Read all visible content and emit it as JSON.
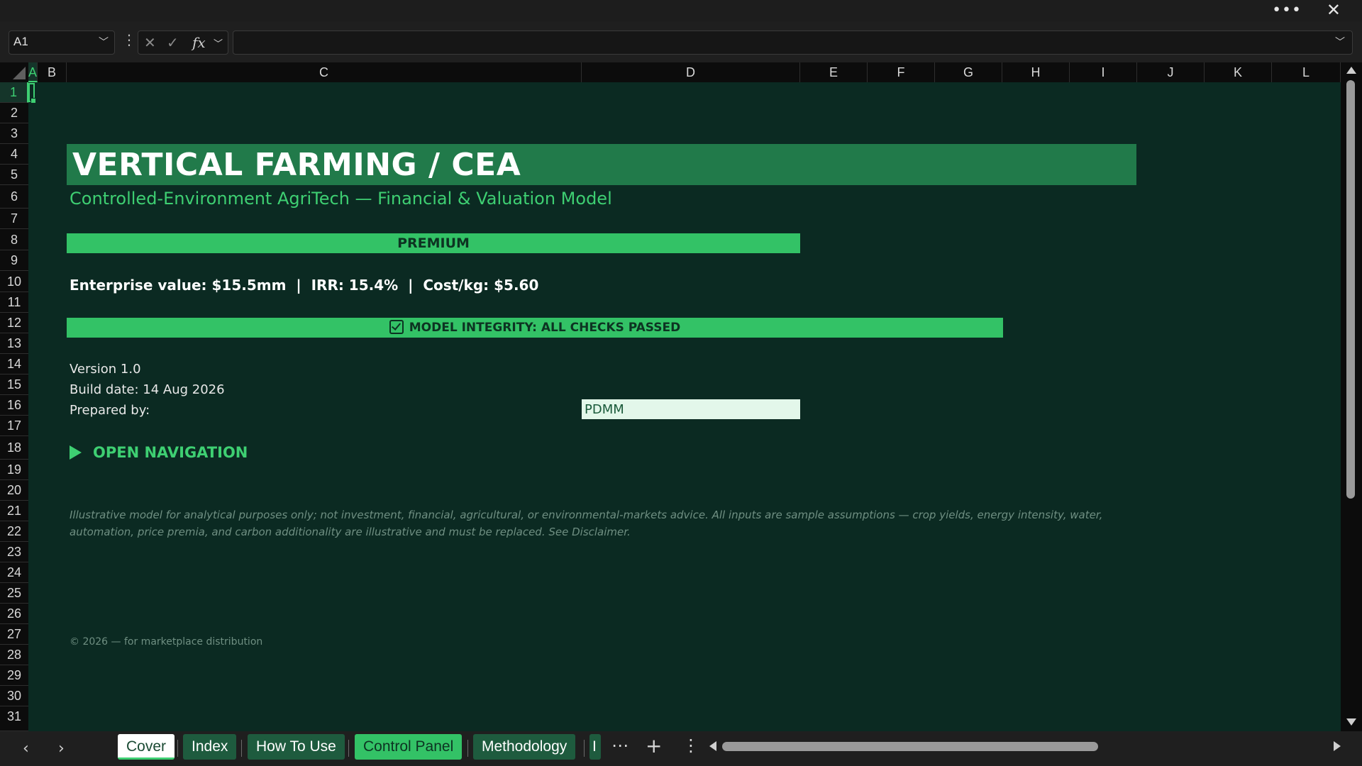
{
  "window": {
    "more_icon": "more-horizontal-icon",
    "close_icon": "close-icon"
  },
  "formula_bar": {
    "name_box": "A1",
    "formula_value": ""
  },
  "columns": [
    "A",
    "B",
    "C",
    "D",
    "E",
    "F",
    "G",
    "H",
    "I",
    "J",
    "K",
    "L"
  ],
  "rows": [
    "1",
    "2",
    "3",
    "4",
    "5",
    "6",
    "7",
    "8",
    "9",
    "10",
    "11",
    "12",
    "13",
    "14",
    "15",
    "16",
    "17",
    "18",
    "19",
    "20",
    "21",
    "22",
    "23",
    "24",
    "25",
    "26",
    "27",
    "28",
    "29",
    "30",
    "31"
  ],
  "cover": {
    "title": "VERTICAL FARMING / CEA",
    "subtitle": "Controlled-Environment AgriTech — Financial & Valuation Model",
    "edition": "PREMIUM",
    "kpis": "Enterprise value: $15.5mm  |  IRR: 15.4%  |  Cost/kg: $5.60",
    "integrity": "MODEL INTEGRITY: ALL CHECKS PASSED",
    "version": "Version 1.0",
    "build_date": "Build date: 14 Aug 2026",
    "prepared_by_label": "Prepared by:",
    "prepared_by_value": "PDMM",
    "nav_link": "OPEN NAVIGATION",
    "disclaimer": "Illustrative model for analytical purposes only; not investment, financial, agricultural, or environmental-markets advice. All inputs are sample assumptions — crop yields, energy intensity, water, automation, price premia, and carbon additionality are illustrative and must be replaced. See Disclaimer.",
    "copyright": "© 2026 — for marketplace distribution"
  },
  "tabs": [
    {
      "label": "Cover",
      "state": "active"
    },
    {
      "label": "Index",
      "state": "normal"
    },
    {
      "label": "How To Use",
      "state": "normal"
    },
    {
      "label": "Control Panel",
      "state": "highlight"
    },
    {
      "label": "Methodology",
      "state": "normal"
    },
    {
      "label": "I",
      "state": "normal"
    }
  ],
  "colors": {
    "accent": "#33c266",
    "sheet_bg": "#0b2a22",
    "title_bg": "#217a4a",
    "text_green": "#3ecf72"
  }
}
